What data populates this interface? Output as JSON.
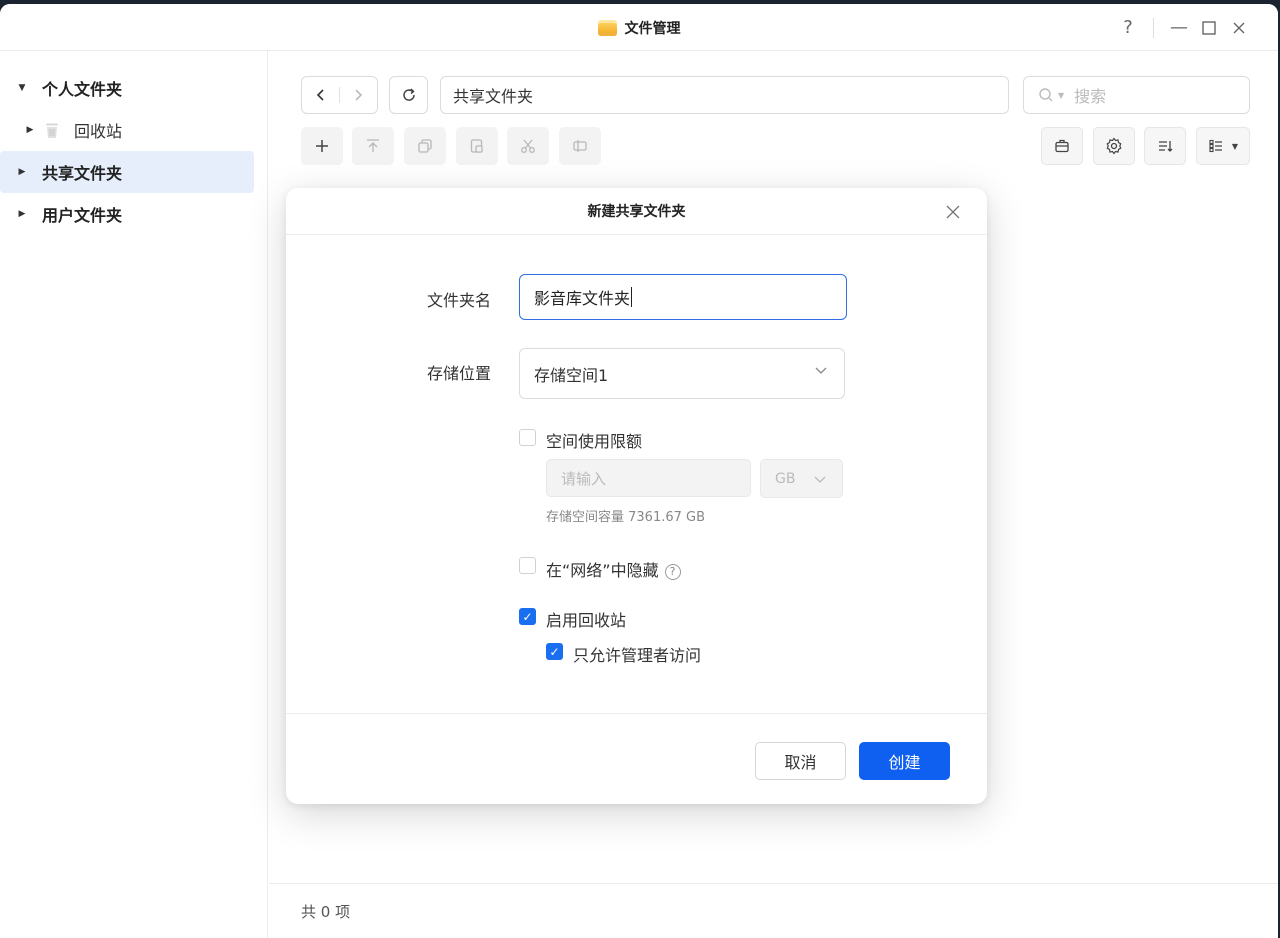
{
  "window": {
    "title": "文件管理",
    "controls": {
      "help": "?",
      "minimize": "—",
      "maximize": "☐",
      "close": "✕"
    }
  },
  "sidebar": {
    "items": [
      {
        "label": "个人文件夹",
        "expanded": true,
        "bold": true
      },
      {
        "label": "回收站",
        "icon": "trash-icon",
        "indent": 1
      },
      {
        "label": "共享文件夹",
        "bold": true,
        "active": true
      },
      {
        "label": "用户文件夹",
        "bold": true
      }
    ]
  },
  "toolbar": {
    "path": "共享文件夹",
    "search_placeholder": "搜索"
  },
  "statusbar": {
    "count_text": "共 0 项"
  },
  "dialog": {
    "title": "新建共享文件夹",
    "folder_name_label": "文件夹名",
    "folder_name_value": "影音库文件夹",
    "storage_label": "存储位置",
    "storage_value": "存储空间1",
    "quota_label": "空间使用限额",
    "quota_placeholder": "请输入",
    "quota_unit": "GB",
    "capacity_note": "存储空间容量 7361.67 GB",
    "hide_label": "在“网络”中隐藏",
    "recycle_label": "启用回收站",
    "admin_only_label": "只允许管理者访问",
    "cancel_label": "取消",
    "create_label": "创建"
  },
  "colors": {
    "accent": "#0f5ff0",
    "active_row": "#e6eefb"
  }
}
